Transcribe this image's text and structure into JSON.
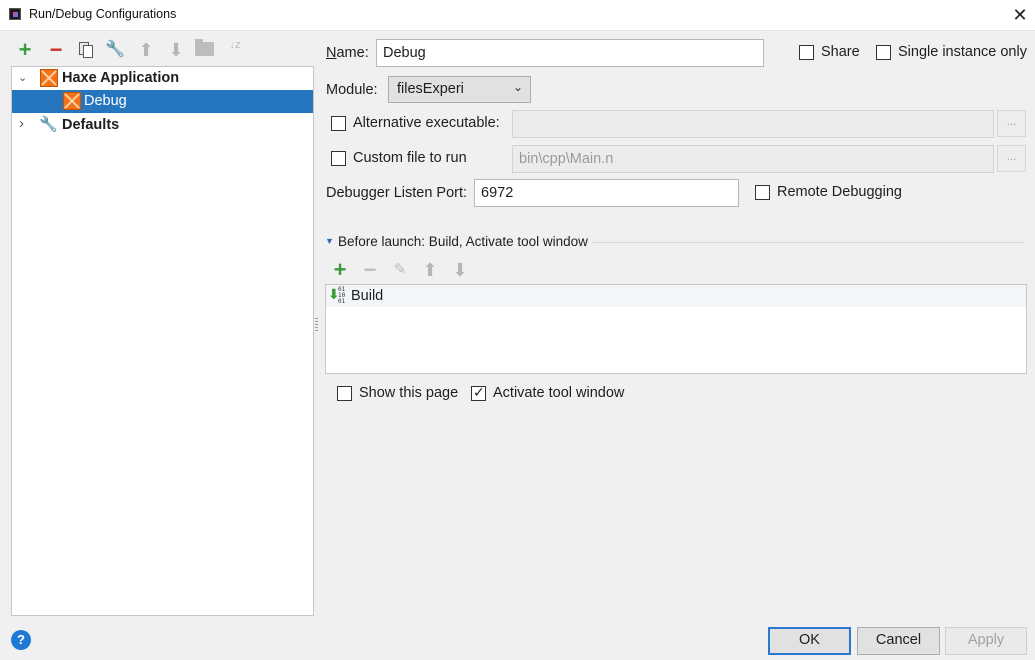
{
  "window": {
    "title": "Run/Debug Configurations",
    "close_glyph": "✕"
  },
  "toolbar": {
    "add_glyph": "+",
    "remove_glyph": "−",
    "wrench_glyph": "🔧",
    "up_glyph": "⬆",
    "down_glyph": "⬇",
    "sort_glyph": "↓z"
  },
  "tree": {
    "items": [
      {
        "label": "Haxe Application",
        "expander": "⌄",
        "icon": "haxe-icon",
        "bold": true
      },
      {
        "label": "Debug",
        "icon": "haxe-icon",
        "selected": true
      },
      {
        "label": "Defaults",
        "expander": "›",
        "icon": "wrench-icon",
        "bold": true
      }
    ]
  },
  "help": {
    "glyph": "?"
  },
  "form": {
    "name_label": "Name:",
    "name_value": "Debug",
    "share_label": "Share",
    "single_instance_label": "Single instance only",
    "module_label": "Module:",
    "module_value": "filesExperi",
    "combo_arrow": "⌄",
    "alt_exec_label": "Alternative executable:",
    "alt_exec_value": "",
    "browse_label": "...",
    "custom_file_label": "Custom file to run",
    "custom_file_value": "bin\\cpp\\Main.n",
    "port_label": "Debugger Listen Port:",
    "port_value": "6972",
    "remote_debug_label": "Remote Debugging"
  },
  "before_launch": {
    "arrow": "▼",
    "title": "Before launch: Build, Activate tool window",
    "add_glyph": "+",
    "remove_glyph": "−",
    "edit_glyph": "✎",
    "up_glyph": "⬆",
    "down_glyph": "⬇",
    "tasks": [
      {
        "label": "Build",
        "icon": "build-icon",
        "arrow": "⬇",
        "bits": "01\n10\n01"
      }
    ],
    "show_page_label": "Show this page",
    "show_page_checked": false,
    "activate_tool_label": "Activate tool window",
    "activate_tool_checked": true
  },
  "buttons": {
    "ok": "OK",
    "cancel": "Cancel",
    "apply": "Apply"
  }
}
